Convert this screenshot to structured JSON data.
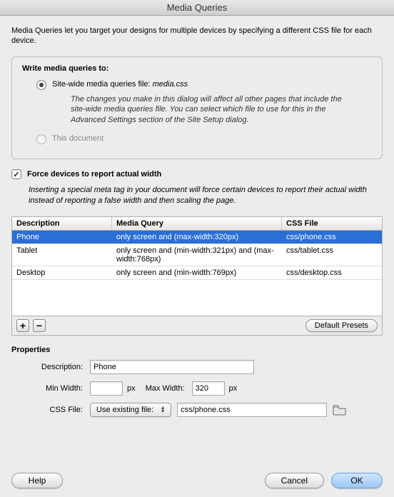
{
  "title": "Media Queries",
  "intro": "Media Queries let you target your designs for multiple devices by specifying a different CSS file for each device.",
  "panel": {
    "title": "Write media queries to:",
    "option_sitewide_label": "Site-wide media queries file:",
    "option_sitewide_file": "media.css",
    "option_sitewide_desc": "The changes you make in this dialog will affect all other pages that include the site-wide media queries file. You can select which file to use for this in the Advanced Settings section of the Site Setup dialog.",
    "option_thisdoc_label": "This document"
  },
  "force": {
    "label": "Force devices to report actual width",
    "desc": "Inserting a special meta tag in your document will force certain devices to report their actual width instead of reporting a false width and then scaling the page."
  },
  "table": {
    "headers": {
      "c1": "Description",
      "c2": "Media Query",
      "c3": "CSS File"
    },
    "rows": [
      {
        "desc": "Phone",
        "mq": "only screen and (max-width:320px)",
        "file": "css/phone.css"
      },
      {
        "desc": "Tablet",
        "mq": "only screen and (min-width:321px) and (max-width:768px)",
        "file": "css/tablet.css"
      },
      {
        "desc": "Desktop",
        "mq": "only screen and (min-width:769px)",
        "file": "css/desktop.css"
      }
    ],
    "add": "+",
    "remove": "−",
    "defaults": "Default Presets"
  },
  "props": {
    "section": "Properties",
    "desc_label": "Description:",
    "desc_value": "Phone",
    "minw_label": "Min Width:",
    "minw_value": "",
    "maxw_label": "Max Width:",
    "maxw_value": "320",
    "px": "px",
    "cssfile_label": "CSS File:",
    "cssfile_mode": "Use existing file:",
    "cssfile_value": "css/phone.css"
  },
  "buttons": {
    "help": "Help",
    "cancel": "Cancel",
    "ok": "OK"
  }
}
